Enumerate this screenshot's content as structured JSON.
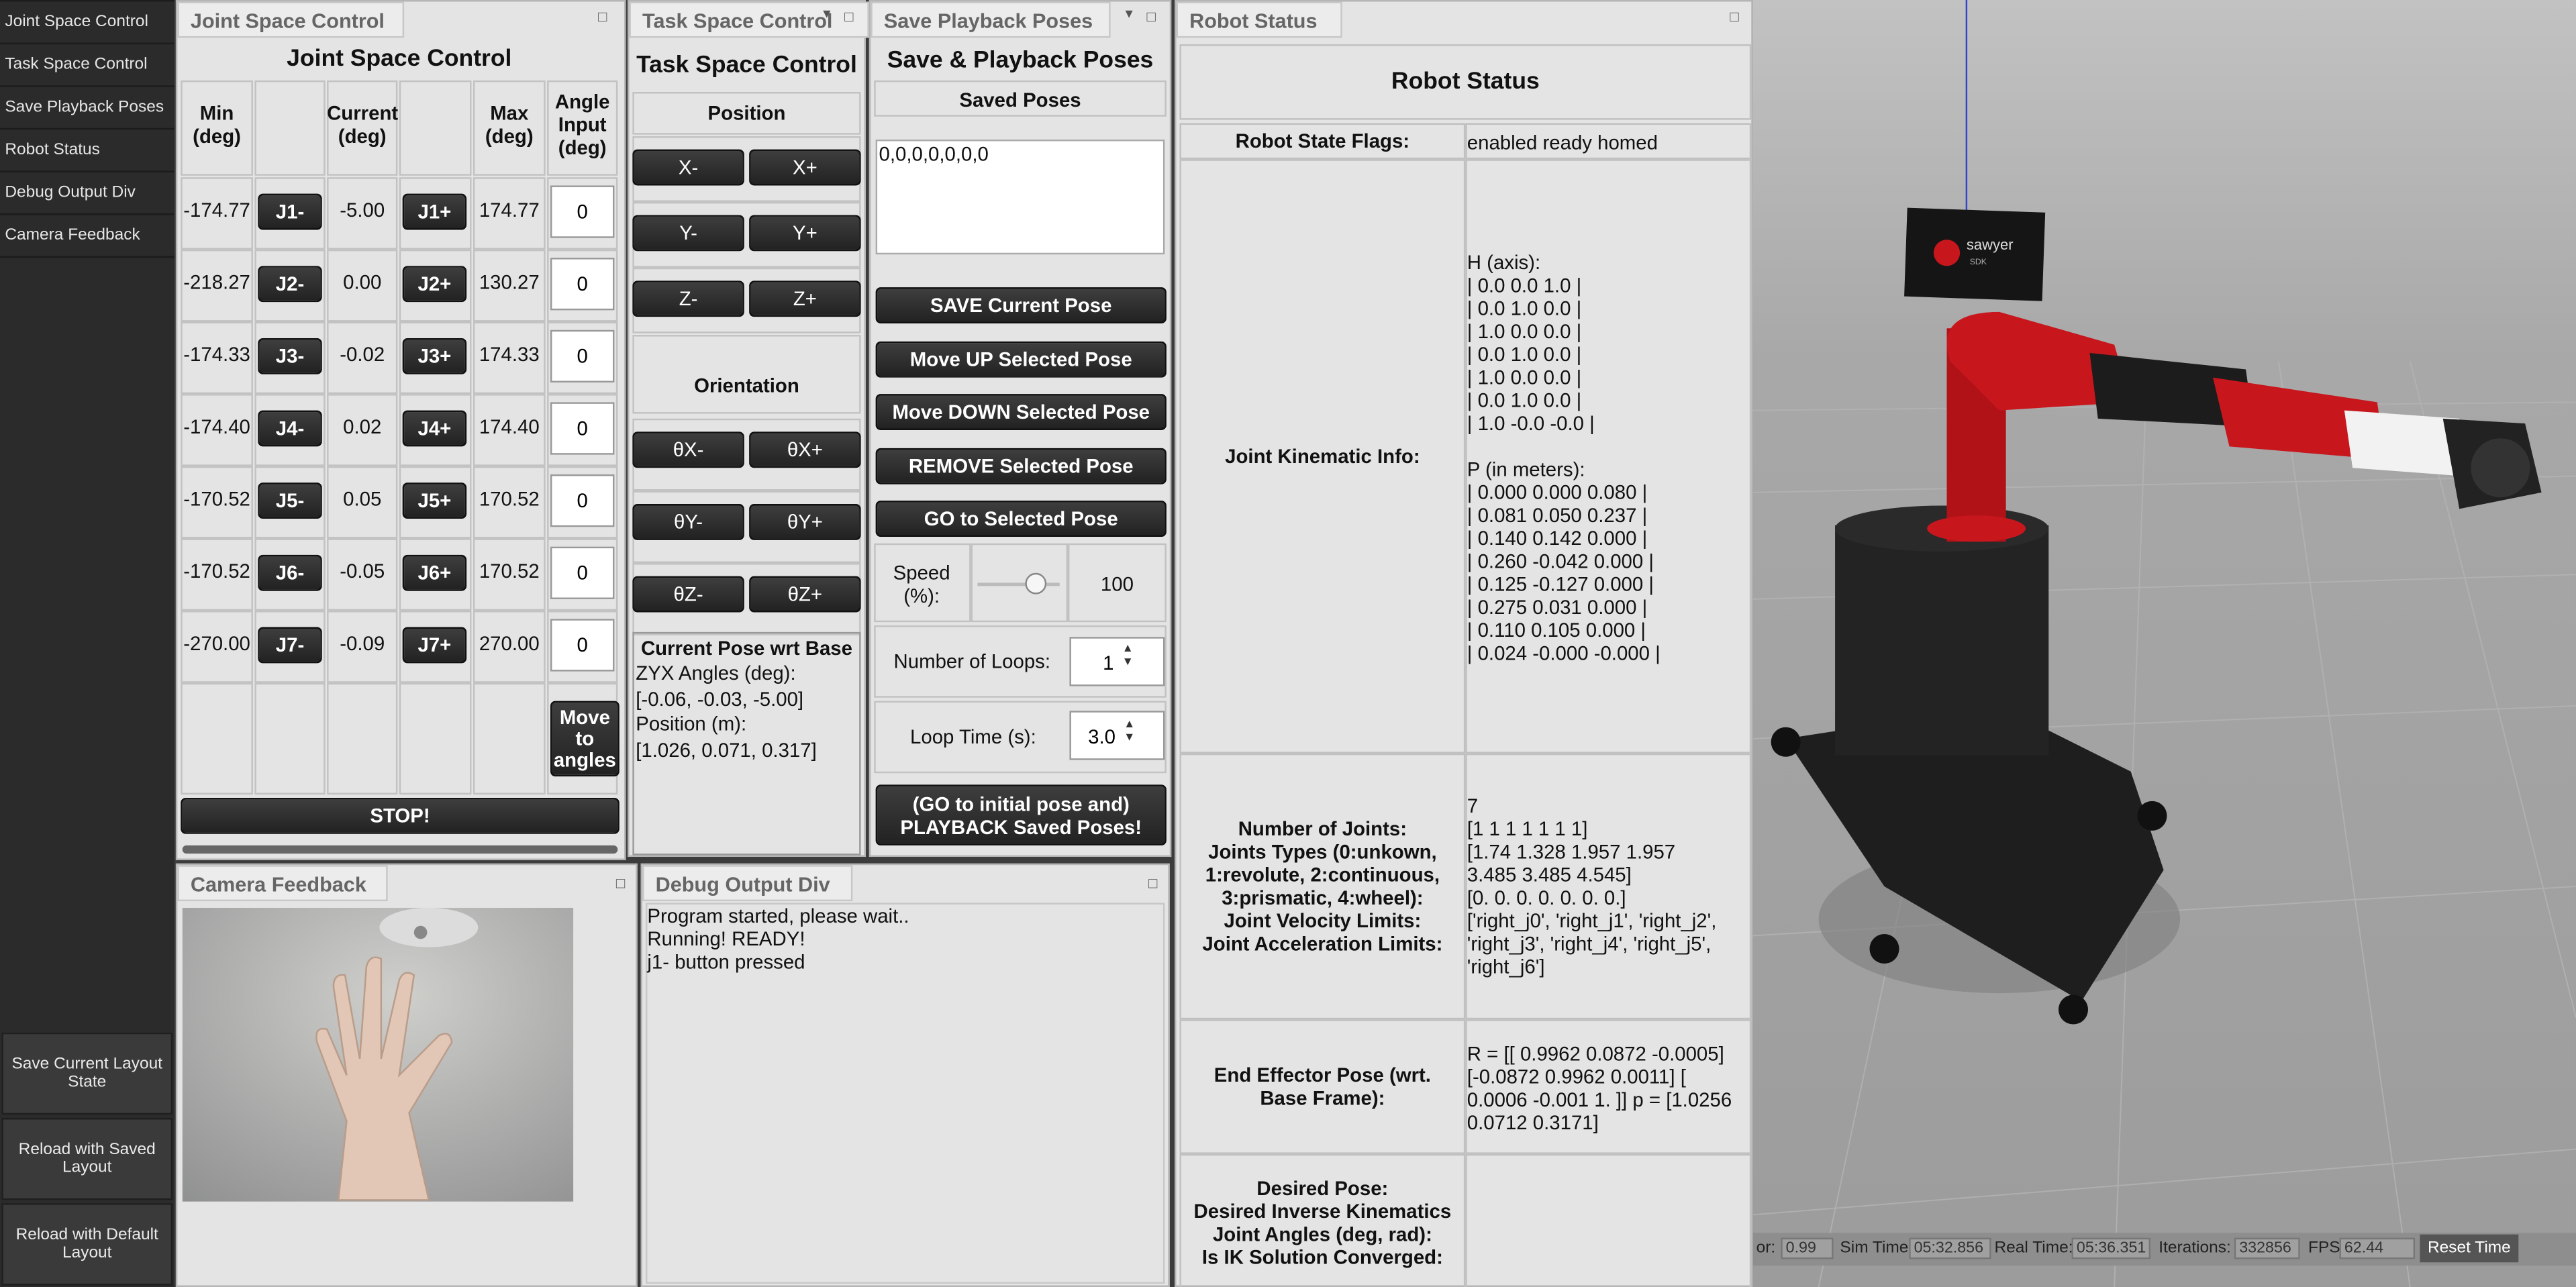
{
  "nav": {
    "items": [
      "Joint Space Control",
      "Task Space Control",
      "Save Playback Poses",
      "Robot Status",
      "Debug Output Div",
      "Camera Feedback"
    ],
    "buttons": [
      "Save Current Layout State",
      "Reload with Saved Layout",
      "Reload with Default Layout"
    ]
  },
  "joint": {
    "tab": "Joint Space Control",
    "title": "Joint Space Control",
    "headers": {
      "min": "Min (deg)",
      "current": "Current (deg)",
      "max": "Max (deg)",
      "angle": "Angle Input (deg)"
    },
    "rows": [
      {
        "min": "-174.77",
        "minus": "J1-",
        "cur": "-5.00",
        "plus": "J1+",
        "max": "174.77",
        "input": "0"
      },
      {
        "min": "-218.27",
        "minus": "J2-",
        "cur": "0.00",
        "plus": "J2+",
        "max": "130.27",
        "input": "0"
      },
      {
        "min": "-174.33",
        "minus": "J3-",
        "cur": "-0.02",
        "plus": "J3+",
        "max": "174.33",
        "input": "0"
      },
      {
        "min": "-174.40",
        "minus": "J4-",
        "cur": "0.02",
        "plus": "J4+",
        "max": "174.40",
        "input": "0"
      },
      {
        "min": "-170.52",
        "minus": "J5-",
        "cur": "0.05",
        "plus": "J5+",
        "max": "170.52",
        "input": "0"
      },
      {
        "min": "-170.52",
        "minus": "J6-",
        "cur": "-0.05",
        "plus": "J6+",
        "max": "170.52",
        "input": "0"
      },
      {
        "min": "-270.00",
        "minus": "J7-",
        "cur": "-0.09",
        "plus": "J7+",
        "max": "270.00",
        "input": "0"
      }
    ],
    "move_btn": "Move to angles",
    "stop_btn": "STOP!"
  },
  "task": {
    "tab": "Task Space Control",
    "title": "Task Space Control",
    "position": "Position",
    "orientation": "Orientation",
    "pos_btns": [
      "X-",
      "X+",
      "Y-",
      "Y+",
      "Z-",
      "Z+"
    ],
    "ori_btns": [
      "θX-",
      "θX+",
      "θY-",
      "θY+",
      "θZ-",
      "θZ+"
    ],
    "pose_title": "Current Pose wrt Base",
    "pose_lines": [
      "ZYX Angles (deg):",
      "[-0.06, -0.03, -5.00]",
      "Position (m):",
      "[1.026, 0.071, 0.317]"
    ]
  },
  "save": {
    "tab": "Save Playback Poses",
    "title": "Save & Playback Poses",
    "saved": "Saved Poses",
    "list": [
      "0,0,0,0,0,0,0"
    ],
    "buttons": [
      "SAVE Current Pose",
      "Move UP Selected Pose",
      "Move DOWN Selected Pose",
      "REMOVE Selected Pose",
      "GO to Selected Pose"
    ],
    "speed_label": "Speed (%):",
    "speed_value": "100",
    "speed_level": 0.7,
    "loops_label": "Number of Loops:",
    "loops_value": "1",
    "looptime_label": "Loop Time (s):",
    "looptime_value": "3.0",
    "playback_btn": "(GO to initial pose and) PLAYBACK Saved Poses!"
  },
  "status": {
    "tab": "Robot Status",
    "title": "Robot Status",
    "flags_label": "Robot State Flags:",
    "flags_value": "enabled ready homed",
    "kin_label": "Joint Kinematic Info:",
    "kin_lines": [
      "H (axis):",
      "| 0.0 0.0 1.0 |",
      "| 0.0 1.0 0.0 |",
      "| 1.0 0.0 0.0 |",
      "| 0.0 1.0 0.0 |",
      "| 1.0 0.0 0.0 |",
      "| 0.0 1.0 0.0 |",
      "| 1.0 -0.0 -0.0 |",
      "",
      "P (in meters):",
      "| 0.000 0.000 0.080 |",
      "| 0.081 0.050 0.237 |",
      "| 0.140 0.142 0.000 |",
      "| 0.260 -0.042 0.000 |",
      "| 0.125 -0.127 0.000 |",
      "| 0.275 0.031 0.000 |",
      "| 0.110 0.105 0.000 |",
      "| 0.024 -0.000 -0.000 |"
    ],
    "joint_labels": [
      "Number of Joints:",
      "Joints Types (0:unkown, 1:revolute, 2:continuous, 3:prismatic, 4:wheel):",
      "Joint Velocity Limits:",
      "Joint Acceleration Limits:"
    ],
    "joint_values": [
      "7",
      "[1 1 1 1 1 1 1]",
      "[1.74 1.328 1.957 1.957 3.485 3.485 4.545]",
      "[0. 0. 0. 0. 0. 0. 0.]",
      "['right_j0', 'right_j1', 'right_j2', 'right_j3', 'right_j4', 'right_j5', 'right_j6']"
    ],
    "ee_label": "End Effector Pose (wrt. Base Frame):",
    "ee_value": "R = [[ 0.9962 0.0872 -0.0005] [-0.0872 0.9962 0.0011] [ 0.0006 -0.001 1. ]] p = [1.0256 0.0712 0.3171]",
    "desired_labels": [
      "Desired Pose:",
      "Desired Inverse Kinematics Joint Angles (deg, rad):",
      "Is IK Solution Converged:"
    ]
  },
  "camera": {
    "tab": "Camera Feedback"
  },
  "debug": {
    "tab": "Debug Output Div",
    "lines": [
      "Program started, please wait..",
      "Running! READY!",
      "j1- button pressed"
    ]
  },
  "sim": {
    "logo_brand": "sawyer",
    "logo_sub": "SDK",
    "factor_label": "or:",
    "factor_value": "0.99",
    "simtime_label": "Sim Time:",
    "simtime_value": "05:32.856",
    "realtime_label": "Real Time:",
    "realtime_value": "05:36.351",
    "iter_label": "Iterations:",
    "iter_value": "332856",
    "fps_label": "FPS:",
    "fps_value": "62.44",
    "reset_btn": "Reset Time"
  },
  "colors": {
    "robot_red": "#c8161d",
    "robot_black": "#1c1c1c",
    "nav_bg": "#2b2b2b",
    "panel_bg": "#e4e4e4"
  }
}
